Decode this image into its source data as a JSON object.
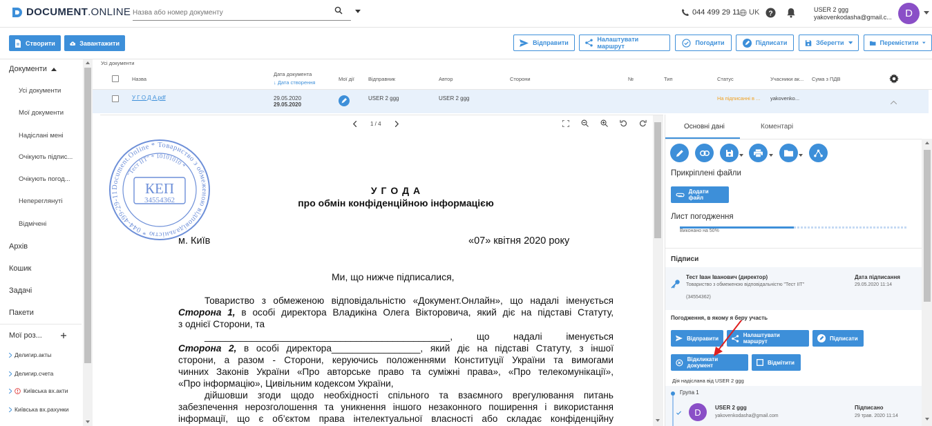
{
  "header": {
    "logo_bold": "DOCUMENT",
    "logo_light": ".ONLINE",
    "search_placeholder": "Назва або номер документу",
    "phone": "044 499 29 11",
    "language": "UK",
    "user_name": "USER 2 ggg",
    "user_email": "yakovenkodasha@gmail.c...",
    "avatar_letter": "D"
  },
  "toolbar": {
    "create": "Створити",
    "upload": "Завантажити",
    "send": "Відправити",
    "route": "Налаштувати маршрут",
    "approve": "Погодити",
    "sign": "Підписати",
    "save": "Зберегти",
    "move": "Перемістити"
  },
  "sidebar": {
    "documents": "Документи",
    "sub": [
      "Усі документи",
      "Мої документи",
      "Надіслані мені",
      "Очікують підпис...",
      "Очікують погод...",
      "Непереглянуті",
      "Відмічені"
    ],
    "archive": "Архів",
    "trash": "Кошик",
    "tasks": "Задачі",
    "packages": "Пакети",
    "my_sections": "Мої роз...",
    "tree": [
      "Делигир.акты",
      "Делигир.счета",
      "Київська вх.акти",
      "Київська вх.рахунки"
    ]
  },
  "table": {
    "crumb": "Усі документи",
    "headers": {
      "name": "Назва",
      "doc_date": "Дата документа",
      "created": "↓ Дата створення",
      "my_actions": "Мої дії",
      "sender": "Відправник",
      "author": "Автор",
      "parties": "Сторони",
      "num": "№",
      "type": "Тип",
      "status": "Статус",
      "participants": "Учасники ак...",
      "vat": "Сума з ПДВ"
    },
    "row": {
      "name": "У Г О Д А.pdf",
      "doc_date": "29.05.2020",
      "created": "29.05.2020",
      "sender": "USER 2 ggg",
      "author": "USER 2 ggg",
      "status": "На підписанні в ...",
      "participants": "yakovenko..."
    }
  },
  "viewer": {
    "page": "1 / 4",
    "stamp": {
      "ring_text": "Document.Online * Товариство з обмеженою відповідальністю * 044-499-29-11 *",
      "inner": "\"Тест ІІТ\" * 10101010 *",
      "kep": "КЕП",
      "code": "34554362"
    },
    "doc": {
      "title": "У Г О Д А",
      "subtitle": "про обмін конфіденційною інформацією",
      "city": "м. Київ",
      "date": "«07» квітня 2020 року",
      "intro": "Ми, що нижче підписалися,",
      "p1_l1": "Товариство з обмеженою відповідальністю «Документ.Онлайн», що надалі іменується",
      "p1_l2a": "Сторона 1,",
      "p1_l2b": " в особі директора Владикіна Олега Вікторовича, який діє на підставі Статуту,",
      "p1_l3": "з однієї Сторони, та",
      "p2_l1": "_______________________________________________, що надалі іменується",
      "p2_l2a": "Сторона 2,",
      "p2_l2b": " в особі  директора_________________, який діє на підставі Статуту, з іншої",
      "p2_l3": "сторони, а разом - Сторони, керуючись положеннями Конституції України та вимогами",
      "p2_l4": "чинних Законів України «Про авторське право та суміжні права», «Про телекомунікації»,",
      "p2_l5": "«Про інформацію», Цивільним кодексом України,",
      "p3_l1": "дійшовши згоди щодо необхідності спільного та взаємного врегулювання питань",
      "p3_l2": "забезпечення нерозголошення та уникнення іншого незаконного поширення і використання",
      "p3_l3": "інформації, що є об’єктом права інтелектуальної власності або складає конфіденційну"
    }
  },
  "panel": {
    "tab_main": "Основні дані",
    "tab_comments": "Коментарі",
    "attached_files": "Прикріплені файли",
    "add_file": "Додати файл",
    "approval_sheet": "Лист погодження",
    "progress_label": "Виконано на 50%",
    "progress": 0.5,
    "signatures": "Підписи",
    "signer_name": "Тест Іван Іванович (директор)",
    "signer_org": "Товариство з обмеженою відповідальністю \"Тест ІІТ\"",
    "signer_code": "(34554362)",
    "sign_date_label": "Дата підписання",
    "sign_date": "29.05.2020 11:14",
    "participation": "Погодження, в якому я беру участь",
    "send": "Відправити",
    "route": "Налаштувати маршрут",
    "sign": "Підписати",
    "revoke": "Відкликати документ",
    "mark": "Відмітити",
    "sent_by": "Дія надіслана від USER 2 ggg",
    "group": "Група 1",
    "member_name": "USER 2 ggg",
    "member_email": "yakovenkodasha@gmail.com",
    "member_status": "Підписано",
    "member_date": "29 трав. 2020 11:14",
    "member_avatar": "D"
  },
  "colors": {
    "accent": "#3d8fd9",
    "status_orange": "#f0a020",
    "avatar": "#8a4fc7",
    "arrow": "#e02020"
  }
}
